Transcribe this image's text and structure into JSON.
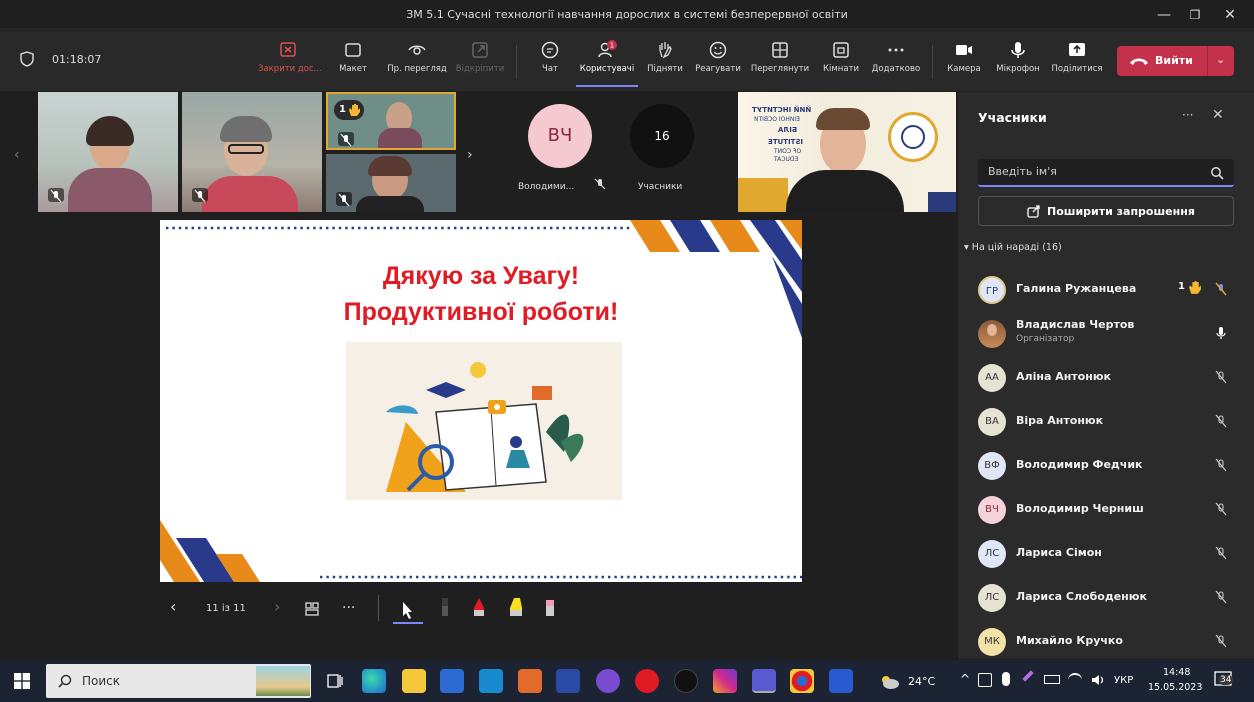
{
  "window": {
    "title": "ЗМ 5.1 Сучасні технології навчання дорослих в системі безперервної освіти",
    "minimize": "—",
    "maximize": "❐",
    "close": "✕"
  },
  "toolbar": {
    "timer": "01:18:07",
    "buttons": [
      {
        "label": "Закрити дос...",
        "icon": "close-share-icon"
      },
      {
        "label": "Макет",
        "icon": "layout-icon"
      },
      {
        "label": "Пр. перегляд",
        "icon": "preview-icon"
      },
      {
        "label": "Відкріпити",
        "icon": "pop-out-icon"
      },
      {
        "label": "Чат",
        "icon": "chat-icon"
      },
      {
        "label": "Користувачі",
        "icon": "people-icon",
        "badge": "1"
      },
      {
        "label": "Підняти",
        "icon": "raise-hand-icon"
      },
      {
        "label": "Реагувати",
        "icon": "react-icon"
      },
      {
        "label": "Переглянути",
        "icon": "view-icon"
      },
      {
        "label": "Кімнати",
        "icon": "rooms-icon"
      },
      {
        "label": "Додатково",
        "icon": "more-icon"
      },
      {
        "label": "Камера",
        "icon": "camera-icon"
      },
      {
        "label": "Мікрофон",
        "icon": "mic-icon"
      },
      {
        "label": "Поділитися",
        "icon": "share-icon"
      }
    ],
    "leave_label": "Вийти"
  },
  "stage": {
    "tiles": {
      "hand_count": "1",
      "avatar_initials": "ВЧ",
      "avatar_name": "Володими...",
      "participants_count": "16",
      "participants_label": "Учасники"
    },
    "background_tile_text": {
      "line1": "ЙИЙ ІНСТИТУТ",
      "line2": "ЕІЙНОЇ ОСВІТИ",
      "line3": "БІЛА",
      "line4": "ISTITUTE",
      "line5": "OF CONT",
      "line6": "EDUCAT"
    },
    "slide": {
      "line1": "Дякую за Увагу!",
      "line2": "Продуктивної роботи!"
    },
    "slide_nav": {
      "counter": "11 із 11",
      "more": "···"
    }
  },
  "panel": {
    "title": "Учасники",
    "more": "···",
    "close": "✕",
    "search_placeholder": "Введіть ім'я",
    "invite_label": "Поширити запрошення",
    "section_label": "На цій нараді (16)",
    "participants": [
      {
        "initials": "ГР",
        "name": "Галина Ружанцева",
        "role": "",
        "hand": "1"
      },
      {
        "initials": "",
        "name": "Владислав Чертов",
        "role": "Організатор"
      },
      {
        "initials": "АА",
        "name": "Аліна Антонюк",
        "role": ""
      },
      {
        "initials": "ВА",
        "name": "Віра Антонюк",
        "role": ""
      },
      {
        "initials": "ВФ",
        "name": "Володимир Федчик",
        "role": ""
      },
      {
        "initials": "ВЧ",
        "name": "Володимир Черниш",
        "role": ""
      },
      {
        "initials": "ЛС",
        "name": "Лариса Сімон",
        "role": ""
      },
      {
        "initials": "ЛС",
        "name": "Лариса Слободенюк",
        "role": ""
      },
      {
        "initials": "МК",
        "name": "Михайло Кручко",
        "role": ""
      }
    ]
  },
  "taskbar": {
    "search_label": "Поиск",
    "weather": "24°C",
    "language": "УКР",
    "time": "14:48",
    "date": "15.05.2023",
    "notification_count": "34"
  }
}
